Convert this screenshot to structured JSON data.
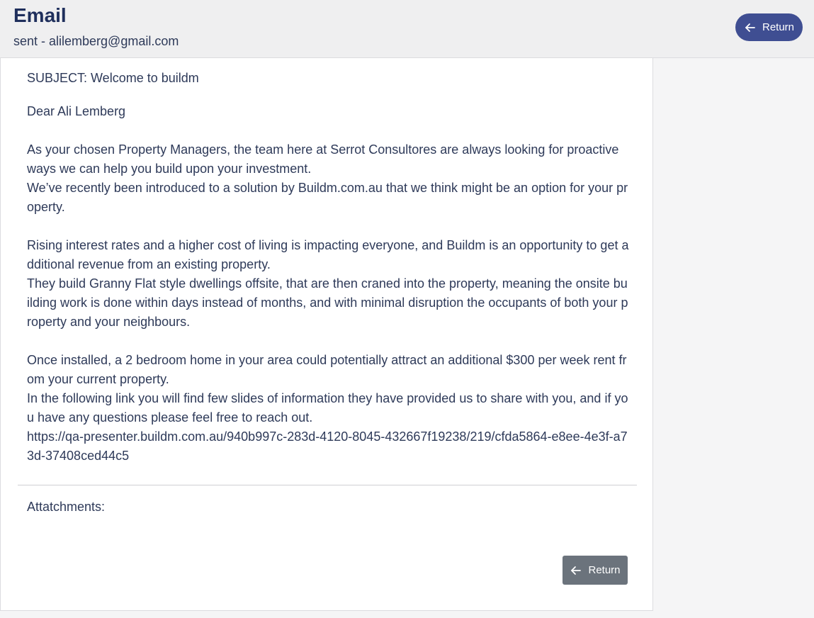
{
  "header": {
    "title": "Email",
    "subtitle": "sent - alilemberg@gmail.com",
    "return_label": "Return",
    "return_icon": "arrow-left-icon"
  },
  "email": {
    "subject": "SUBJECT: Welcome to buildm",
    "body": "Dear Ali Lemberg\n\nAs your chosen Property Managers, the team here at Serrot Consultores are always looking for proactive ways we can help you build upon your investment.\nWe’ve recently been introduced to a solution by Buildm.com.au that we think might be an option for your property.\n\nRising interest rates and a higher cost of living is impacting everyone, and Buildm is an opportunity to get additional revenue from an existing property.\nThey build Granny Flat style dwellings offsite, that are then craned into the property, meaning the onsite building work is done within days instead of months, and with minimal disruption the occupants of both your property and your neighbours.\n\nOnce installed, a 2 bedroom home in your area could potentially attract an additional $300 per week rent from your current property.\nIn the following link you will find few slides of information they have provided us to share with you, and if you have any questions please feel free to reach out.\nhttps://qa-presenter.buildm.com.au/940b997c-283d-4120-8045-432667f19238/219/cfda5864-e8ee-4e3f-a73d-37408ced44c5",
    "attachments_label": "Attatchments:"
  },
  "footer": {
    "return_label": "Return",
    "return_icon": "arrow-left-icon"
  },
  "colors": {
    "header_bg": "#efeff0",
    "primary_button": "#3f4e92",
    "secondary_button": "#6b737c",
    "title_text": "#1f2f5c",
    "body_text": "#2e3a59"
  }
}
